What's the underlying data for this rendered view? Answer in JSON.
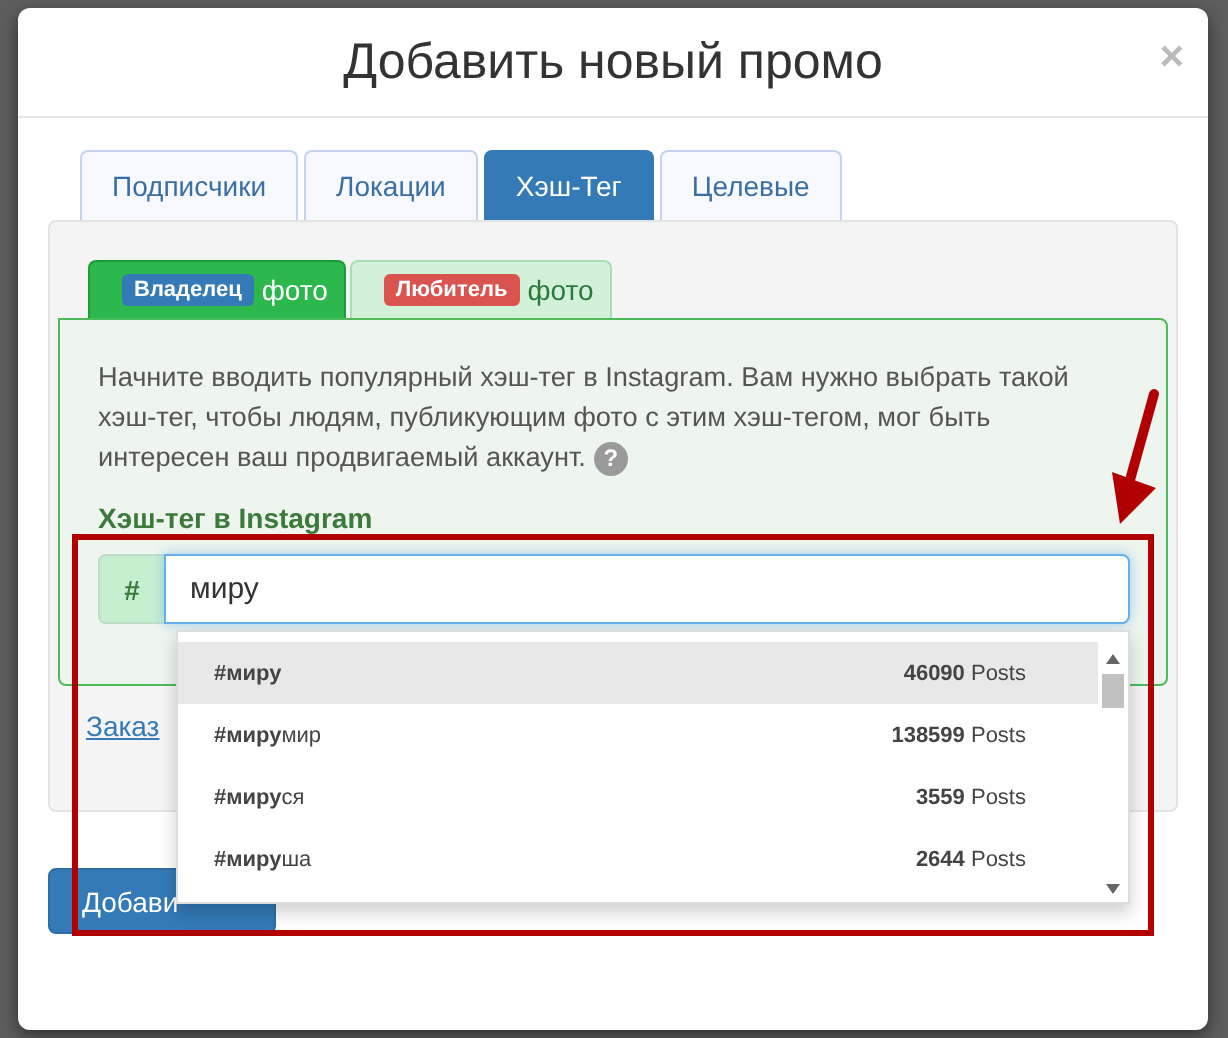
{
  "dialog": {
    "title": "Добавить новый промо",
    "close": "×"
  },
  "tabs": [
    {
      "label": "Подписчики",
      "selected": false
    },
    {
      "label": "Локации",
      "selected": false
    },
    {
      "label": "Хэш-Тег",
      "selected": true
    },
    {
      "label": "Целевые",
      "selected": false
    }
  ],
  "photo_tabs": [
    {
      "badge": "Владелец",
      "color": "#337ab7",
      "label": "фото",
      "selected": true
    },
    {
      "badge": "Любитель",
      "color": "#d9534f",
      "label": "фото",
      "selected": false
    }
  ],
  "description": "Начните вводить популярный хэш-тег в Instagram. Вам нужно выбрать такой хэш-тег, чтобы людям, публикующим фото с этим хэш-тегом, мог быть интересен ваш продвигаемый аккаунт.",
  "help": "?",
  "hashtag_field": {
    "label": "Хэш-тег в Instagram",
    "prefix": "#",
    "value": "миру"
  },
  "suggestions": [
    {
      "tag": "**#миру**",
      "count": "**46090** Posts",
      "selected": true
    },
    {
      "tag": "**#миру**мир",
      "count": "**138599** Posts",
      "selected": false
    },
    {
      "tag": "**#миру**ся",
      "count": "**3559** Posts",
      "selected": false
    },
    {
      "tag": "**#миру**ша",
      "count": "**2644** Posts",
      "selected": false
    }
  ],
  "order_link": "Заказ",
  "submit_button": "Добави"
}
